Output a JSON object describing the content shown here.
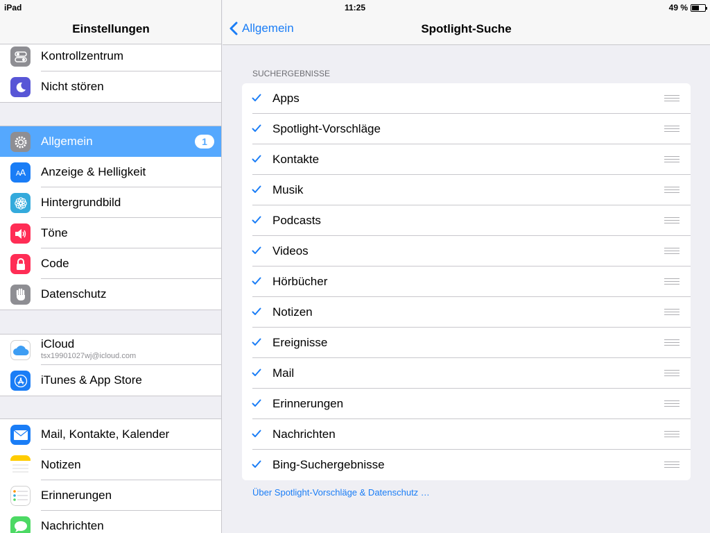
{
  "status_bar": {
    "device": "iPad",
    "time": "11:25",
    "battery_text": "49 %",
    "battery_level": 0.49
  },
  "sidebar": {
    "title": "Einstellungen",
    "group1": [
      {
        "label": "Kontrollzentrum",
        "icon": "control-center-icon",
        "color": "#8e8e93"
      },
      {
        "label": "Nicht stören",
        "icon": "moon-icon",
        "color": "#5856d6"
      }
    ],
    "group2": [
      {
        "label": "Allgemein",
        "icon": "gear-icon",
        "color": "#8e8e93",
        "badge": "1",
        "selected": true
      },
      {
        "label": "Anzeige & Helligkeit",
        "icon": "text-size-icon",
        "color": "#1a7df6",
        "glyph": "AA"
      },
      {
        "label": "Hintergrundbild",
        "icon": "flower-icon",
        "color": "#34aadc"
      },
      {
        "label": "Töne",
        "icon": "speaker-icon",
        "color": "#ff2d55"
      },
      {
        "label": "Code",
        "icon": "lock-icon",
        "color": "#ff2d55"
      },
      {
        "label": "Datenschutz",
        "icon": "hand-icon",
        "color": "#8e8e93"
      }
    ],
    "group3": [
      {
        "label": "iCloud",
        "sub": "tsx19901027wj@icloud.com",
        "icon": "cloud-icon",
        "color": "#ffffff"
      },
      {
        "label": "iTunes & App Store",
        "icon": "app-store-icon",
        "color": "#1a7df6"
      }
    ],
    "group4": [
      {
        "label": "Mail, Kontakte, Kalender",
        "icon": "mail-icon",
        "color": "#1a7df6"
      },
      {
        "label": "Notizen",
        "icon": "notes-icon",
        "color": "#ffcc00"
      },
      {
        "label": "Erinnerungen",
        "icon": "reminders-icon",
        "color": "#ffffff"
      },
      {
        "label": "Nachrichten",
        "icon": "messages-icon",
        "color": "#4cd964"
      }
    ]
  },
  "detail": {
    "back_label": "Allgemein",
    "title": "Spotlight-Suche",
    "section_header": "SUCHERGEBNISSE",
    "items": [
      "Apps",
      "Spotlight-Vorschläge",
      "Kontakte",
      "Musik",
      "Podcasts",
      "Videos",
      "Hörbücher",
      "Notizen",
      "Ereignisse",
      "Mail",
      "Erinnerungen",
      "Nachrichten",
      "Bing-Suchergebnisse"
    ],
    "footer_link": "Über Spotlight-Vorschläge & Datenschutz …",
    "accent": "#1a7df6"
  }
}
